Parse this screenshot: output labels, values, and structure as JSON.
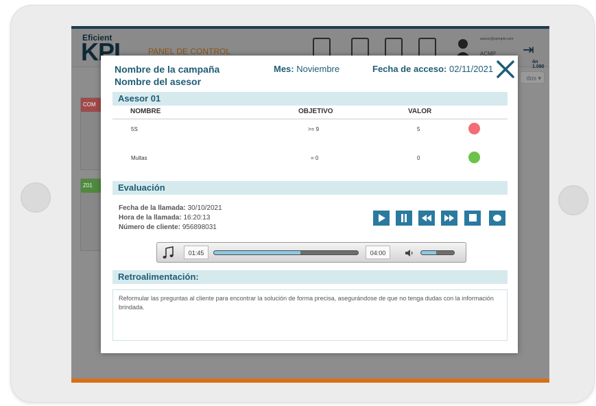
{
  "app": {
    "logo_small": "Eficient",
    "logo_big": "KPI",
    "panel_title": "PANEL DE CONTROL",
    "user_email": "asesor@ejempl​o.com",
    "user_name": "ACMP",
    "version": "ón 1.090",
    "dropdown_value": "dos",
    "card1_caption": "COM",
    "card2_caption": "Z01"
  },
  "modal": {
    "campaign": "Nombre de la campaña",
    "advisor": "Nombre del asesor",
    "month_label": "Mes:",
    "month_value": "Noviembre",
    "access_label": "Fecha de acceso:",
    "access_value": "02/11/2021",
    "close_icon": "close-icon"
  },
  "advisor_section": {
    "title": "Asesor 01",
    "columns": [
      "NOMBRE",
      "OBJETIVO",
      "VALOR"
    ],
    "rows": [
      {
        "name": "5S",
        "objective": ">= 9",
        "value": "5",
        "status_color": "#f26d75"
      },
      {
        "name": "Multas",
        "objective": "= 0",
        "value": "0",
        "status_color": "#6cc24a"
      }
    ]
  },
  "evaluation": {
    "title": "Evaluación",
    "call_date_label": "Fecha de la llamada:",
    "call_date": "30/10/2021",
    "call_time_label": "Hora de la llamada:",
    "call_time": "16:20:13",
    "client_label": "Número de cliente:",
    "client_number": "956898031",
    "controls": [
      "play-icon",
      "pause-icon",
      "rewind-icon",
      "fast-forward-icon",
      "stop-icon",
      "record-icon"
    ],
    "player": {
      "current_time": "01:45",
      "total_time": "04:00",
      "progress": 0.6,
      "volume": 0.45
    }
  },
  "feedback": {
    "title": "Retroalimentación:",
    "text": "Reformular las preguntas al cliente para encontrar la solución de forma precisa, asegurándose de que no tenga dudas con la información brindada."
  },
  "colors": {
    "accent": "#1f5d75",
    "bar_bg": "#d6eaee",
    "control_bg": "#2a7aa0",
    "bottom_line": "#d86f16"
  }
}
